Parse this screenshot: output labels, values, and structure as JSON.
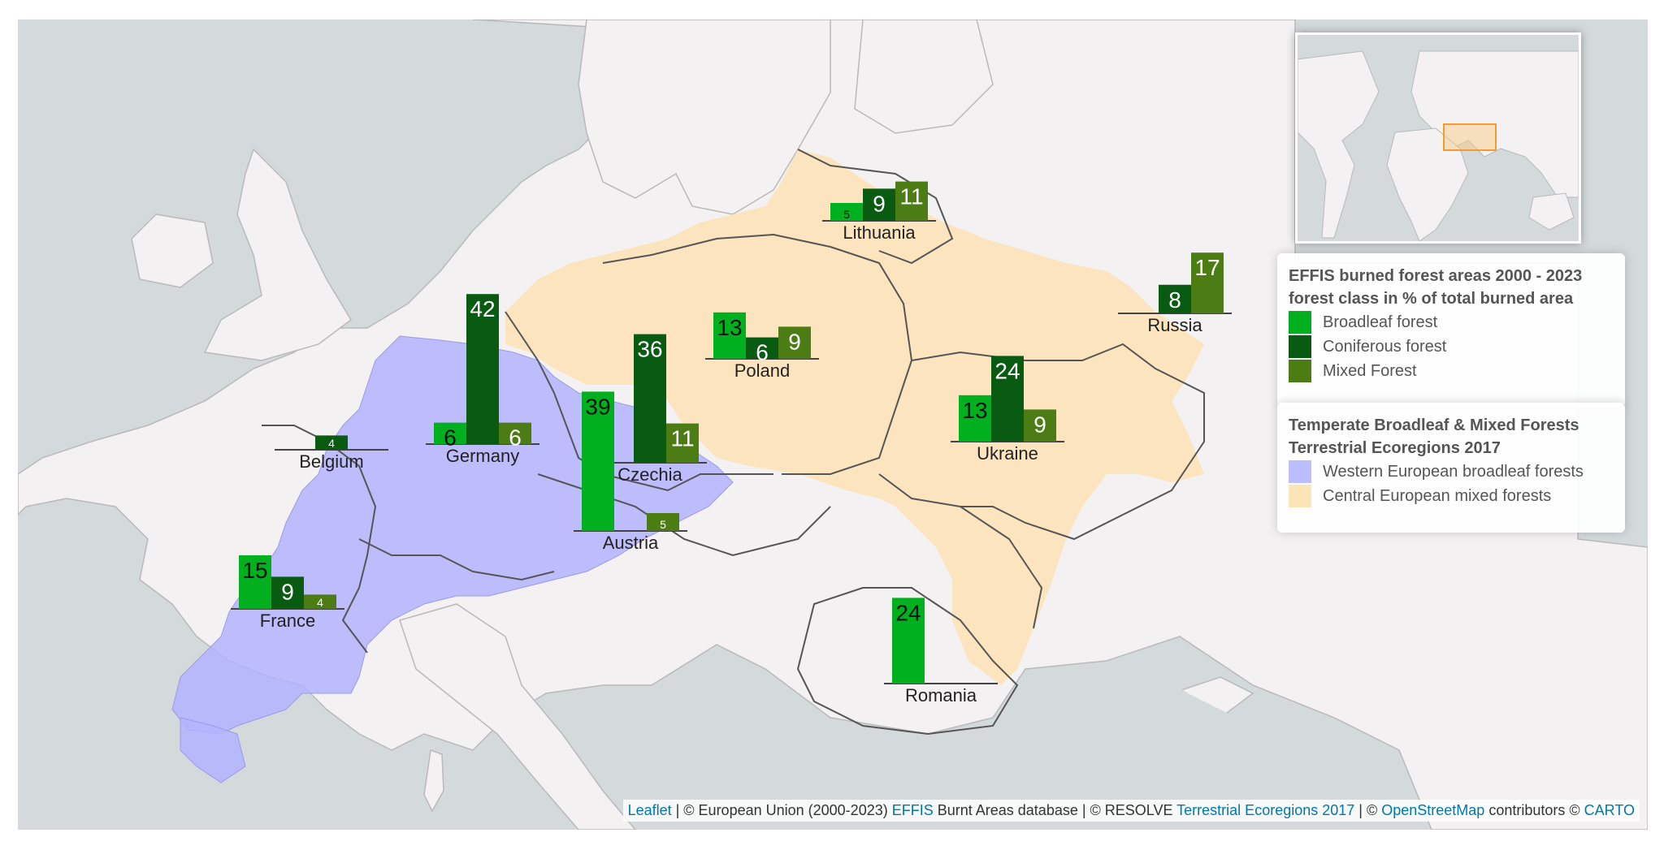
{
  "legend_effis": {
    "title_line1": "EFFIS burned forest areas 2000 - 2023",
    "title_line2": "forest class in % of total burned area",
    "items": [
      {
        "label": "Broadleaf forest",
        "color": "#00b01e"
      },
      {
        "label": "Coniferous forest",
        "color": "#0a5b12"
      },
      {
        "label": "Mixed Forest",
        "color": "#4c7d15"
      }
    ]
  },
  "legend_ecoregions": {
    "title_line1": "Temperate Broadleaf & Mixed Forests",
    "title_line2": "Terrestrial Ecoregions 2017",
    "items": [
      {
        "label": "Western European broadleaf forests",
        "color": "#bcbcff"
      },
      {
        "label": "Central European mixed forests",
        "color": "#fde3b8"
      }
    ]
  },
  "attribution": {
    "leaflet": "Leaflet",
    "eu": " | © European Union (2000-2023) ",
    "effis": "EFFIS",
    "burnt": " Burnt Areas database | © RESOLVE ",
    "teco": "Terrestrial Ecoregions 2017",
    "sep": " | © ",
    "osm": "OpenStreetMap",
    "contrib": " contributors © ",
    "carto": "CARTO"
  },
  "chart_data": {
    "type": "bar",
    "series_names": [
      "Broadleaf forest",
      "Coniferous forest",
      "Mixed Forest"
    ],
    "countries": [
      {
        "name": "Lithuania",
        "values": [
          5,
          9,
          11
        ]
      },
      {
        "name": "Russia",
        "values": [
          null,
          8,
          17
        ]
      },
      {
        "name": "Poland",
        "values": [
          13,
          6,
          9
        ]
      },
      {
        "name": "Germany",
        "values": [
          6,
          42,
          6
        ]
      },
      {
        "name": "Belgium",
        "values": [
          null,
          4,
          null
        ]
      },
      {
        "name": "Czechia",
        "values": [
          null,
          36,
          11
        ]
      },
      {
        "name": "Austria",
        "values": [
          39,
          null,
          5
        ]
      },
      {
        "name": "Ukraine",
        "values": [
          13,
          24,
          9
        ]
      },
      {
        "name": "France",
        "values": [
          15,
          9,
          4
        ]
      },
      {
        "name": "Romania",
        "values": [
          24,
          null,
          null
        ]
      }
    ]
  }
}
